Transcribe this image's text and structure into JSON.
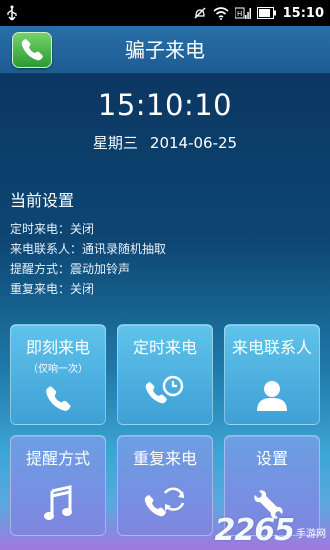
{
  "status_bar": {
    "time": "15:10",
    "icons": [
      "usb-icon",
      "mute-icon",
      "wifi-icon",
      "signal-icon",
      "battery-icon"
    ]
  },
  "app": {
    "title": "骗子来电",
    "icon": "phone-icon",
    "accent": "#3fa0d6"
  },
  "clock": {
    "time": "15:10:10",
    "weekday": "星期三",
    "date": "2014-06-25"
  },
  "settings": {
    "heading": "当前设置",
    "items": [
      "定时来电：关闭",
      "来电联系人：通讯录随机抽取",
      "提醒方式：震动加铃声",
      "重复来电：关闭"
    ]
  },
  "tiles": [
    {
      "label": "即刻来电",
      "sub": "（仅响一次）",
      "icon": "phone-icon"
    },
    {
      "label": "定时来电",
      "icon": "phone-timer-icon"
    },
    {
      "label": "来电联系人",
      "icon": "person-icon"
    },
    {
      "label": "提醒方式",
      "icon": "music-note-icon"
    },
    {
      "label": "重复来电",
      "icon": "phone-repeat-icon"
    },
    {
      "label": "设置",
      "icon": "wrench-icon"
    }
  ],
  "watermark": {
    "number": "2265",
    "sub": "手游网"
  }
}
